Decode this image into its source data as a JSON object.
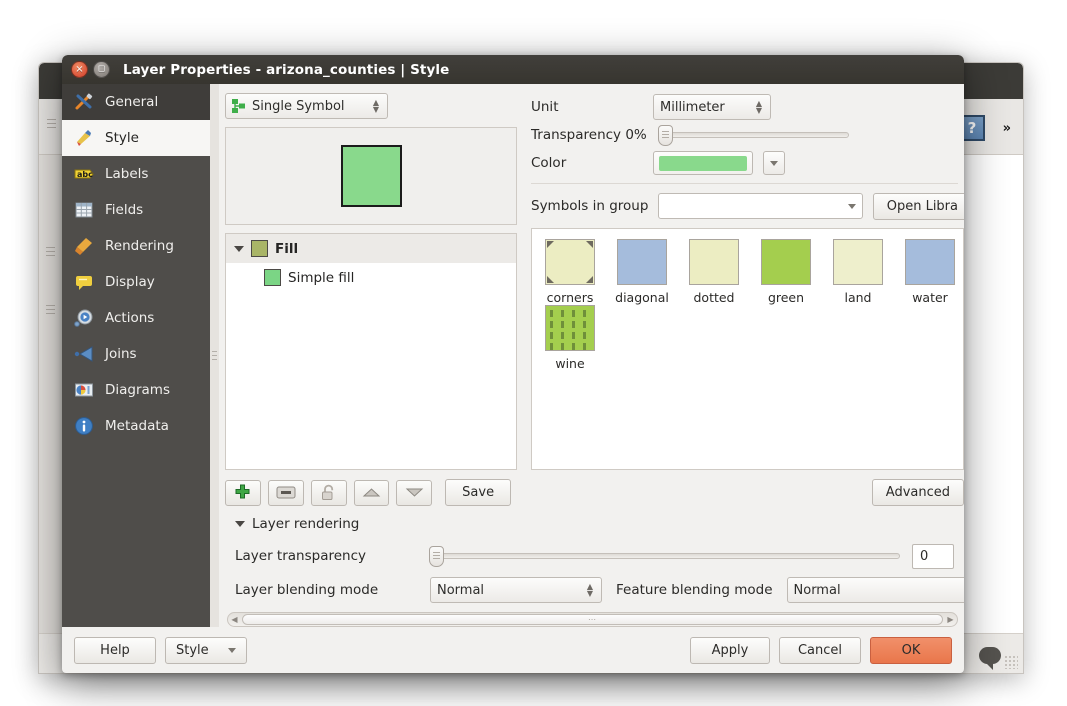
{
  "background_window": {
    "help_icon": "help-question-icon",
    "overflow_chevron": "»",
    "status_bubble_icon": "message-bubble-icon"
  },
  "dialog": {
    "title": "Layer Properties - arizona_counties | Style",
    "window_buttons": {
      "close": "×",
      "maximize": "◻"
    },
    "sidebar": {
      "items": [
        {
          "label": "General",
          "icon": "tools-hammer-screwdriver-icon",
          "state": "hover"
        },
        {
          "label": "Style",
          "icon": "paintbrush-icon",
          "state": "selected"
        },
        {
          "label": "Labels",
          "icon": "abc-label-icon",
          "state": "normal"
        },
        {
          "label": "Fields",
          "icon": "table-grid-icon",
          "state": "normal"
        },
        {
          "label": "Rendering",
          "icon": "broom-icon",
          "state": "normal"
        },
        {
          "label": "Display",
          "icon": "speech-bubble-icon",
          "state": "normal"
        },
        {
          "label": "Actions",
          "icon": "gear-play-icon",
          "state": "normal"
        },
        {
          "label": "Joins",
          "icon": "join-arrow-icon",
          "state": "normal"
        },
        {
          "label": "Diagrams",
          "icon": "diagram-chart-icon",
          "state": "normal"
        },
        {
          "label": "Metadata",
          "icon": "info-circle-icon",
          "state": "normal"
        }
      ]
    },
    "style_panel": {
      "renderer_combo": {
        "value": "Single Symbol",
        "icon": "single-symbol-icon"
      },
      "preview": {
        "fill_color": "#89d98c",
        "stroke_color": "#1b1b1b"
      },
      "symbol_tree": [
        {
          "label": "Fill",
          "swatch": "#a9b567",
          "level": 0,
          "expanded": true
        },
        {
          "label": "Simple fill",
          "swatch": "#7bd585",
          "level": 1,
          "expanded": false
        }
      ],
      "layer_buttons": [
        {
          "name": "add-symbol-layer",
          "icon": "plus-green-icon"
        },
        {
          "name": "remove-symbol-layer",
          "icon": "minus-icon"
        },
        {
          "name": "lock-symbol-layer",
          "icon": "lock-icon"
        },
        {
          "name": "move-up",
          "icon": "triangle-up-icon"
        },
        {
          "name": "move-down",
          "icon": "triangle-down-icon"
        }
      ],
      "save_label": "Save",
      "unit": {
        "label": "Unit",
        "value": "Millimeter"
      },
      "transparency": {
        "label": "Transparency 0%",
        "value": 0
      },
      "color": {
        "label": "Color",
        "value": "#89d98c"
      },
      "symbols_in_group": {
        "label": "Symbols in group",
        "value": "",
        "open_library_label": "Open Libra"
      },
      "gallery": [
        {
          "label": "corners",
          "base": "#ecedc2",
          "pattern": "corners"
        },
        {
          "label": "diagonal",
          "base": "#a5bcdc",
          "pattern": "solid"
        },
        {
          "label": "dotted",
          "base": "#ecedc2",
          "pattern": "dotted"
        },
        {
          "label": "green",
          "base": "#a4ce4e",
          "pattern": "solid"
        },
        {
          "label": "land",
          "base": "#eeefcc",
          "pattern": "solid"
        },
        {
          "label": "water",
          "base": "#a5bcdc",
          "pattern": "solid"
        },
        {
          "label": "wine",
          "base": "#a4ce4e",
          "pattern": "wine"
        }
      ],
      "advanced_label": "Advanced"
    },
    "layer_rendering": {
      "section_title": "Layer rendering",
      "transparency_label": "Layer transparency",
      "transparency_value": "0",
      "layer_blending_label": "Layer blending mode",
      "layer_blending_value": "Normal",
      "feature_blending_label": "Feature blending mode",
      "feature_blending_value": "Normal"
    },
    "footer": {
      "help_label": "Help",
      "style_label": "Style",
      "apply_label": "Apply",
      "cancel_label": "Cancel",
      "ok_label": "OK"
    }
  }
}
